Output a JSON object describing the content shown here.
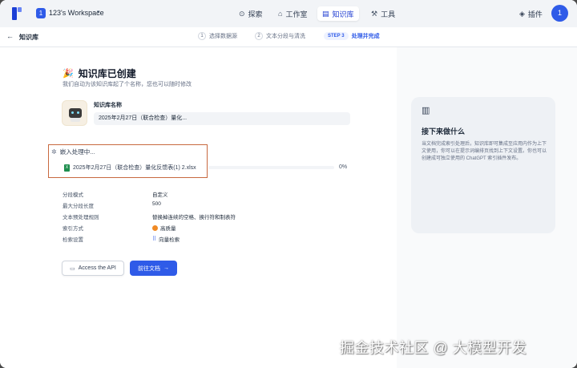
{
  "topbar": {
    "workspace_badge": "1",
    "workspace_name": "123's Workspace",
    "nav": [
      {
        "label": "探索",
        "icon": "explore-icon"
      },
      {
        "label": "工作室",
        "icon": "studio-icon"
      },
      {
        "label": "知识库",
        "icon": "knowledge-icon",
        "active": true
      },
      {
        "label": "工具",
        "icon": "tools-icon"
      }
    ],
    "plugin_label": "插件",
    "avatar_letter": "1"
  },
  "subheader": {
    "title": "知识库",
    "steps": [
      {
        "num": "1",
        "label": "选择数据源"
      },
      {
        "num": "2",
        "label": "文本分段与清洗"
      },
      {
        "tag": "STEP 3",
        "label": "处理并完成"
      }
    ]
  },
  "main": {
    "done_icon": "🎉",
    "done_title": "知识库已创建",
    "done_sub": "我们自动为该知识库起了个名称，您也可以随时修改",
    "name_label": "知识库名称",
    "name_value": "2025年2月27日（联合检查）量化...",
    "embed_status": "嵌入处理中...",
    "file_name": "2025年2月27日（联合检查）量化反馈表(1) 2.xlsx",
    "progress_pct": "0%",
    "progress_value": 0,
    "info": [
      {
        "label": "分段模式",
        "value": "自定义"
      },
      {
        "label": "最大分段长度",
        "value": "500"
      },
      {
        "label": "文本预处理规则",
        "value": "替换掉连续的空格、换行符和制表符"
      },
      {
        "label": "索引方式",
        "value": "高质量"
      },
      {
        "label": "检索设置",
        "value": "向量检索"
      }
    ],
    "api_button": "Access the API",
    "doc_button": "前往文档"
  },
  "aside": {
    "title": "接下来做什么",
    "body": "当文档完成索引处理后，知识库即可集成至应用内作为上下文使用，你可以在提示词编排页找到上下文设置。你也可以创建成可独立使用的 ChatGPT 索引插件发布。"
  },
  "watermark": "掘金技术社区 @ 大模型开发",
  "colors": {
    "accent": "#2f5be8",
    "highlight_border": "#c8693f"
  }
}
